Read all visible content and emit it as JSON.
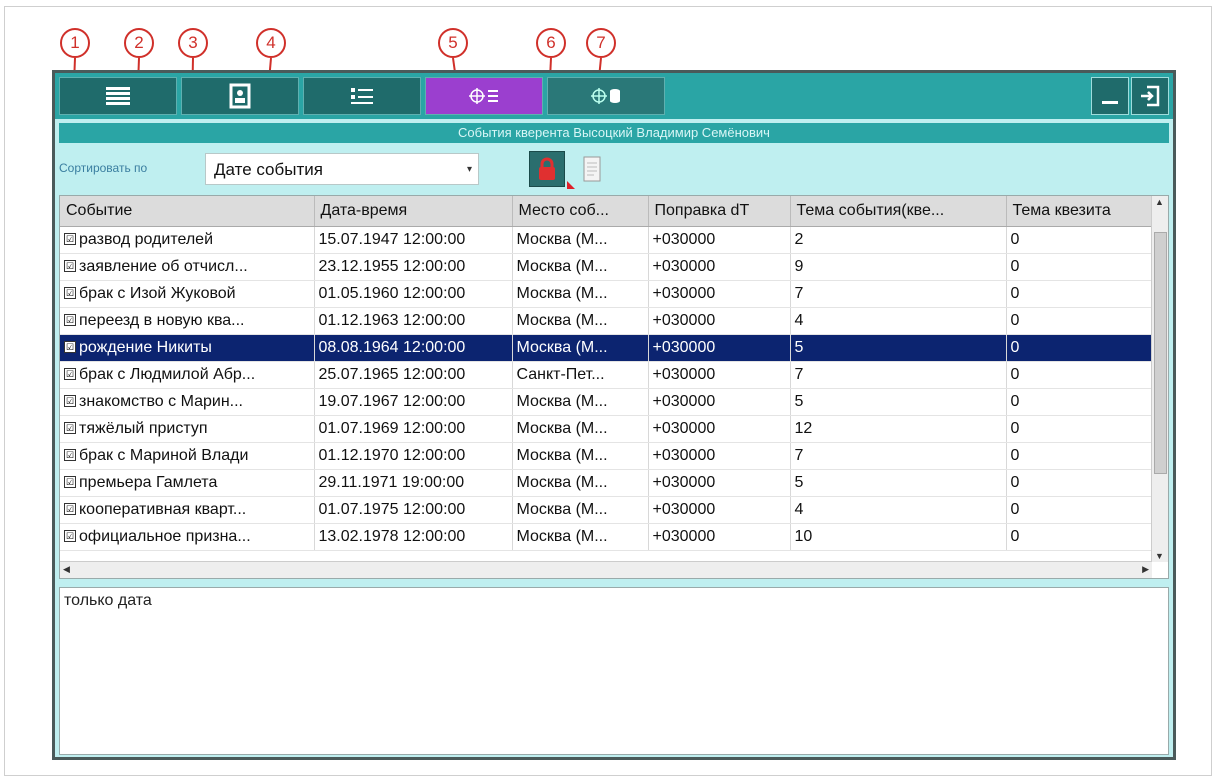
{
  "callouts": [
    "1",
    "2",
    "3",
    "4",
    "5",
    "6",
    "7"
  ],
  "toolbar": {
    "tabs": [
      {
        "icon": "list-icon"
      },
      {
        "icon": "person-card-icon"
      },
      {
        "icon": "numbered-list-icon"
      },
      {
        "icon": "target-list-icon",
        "active": true
      },
      {
        "icon": "target-database-icon"
      }
    ],
    "accent": "#2aa5a5",
    "active_color": "#9b3fcf"
  },
  "window_title": "События кверента   Высоцкий Владимир Семёнович",
  "sort": {
    "label": "Сортировать по",
    "value": "Дате события"
  },
  "table": {
    "columns": [
      "Событие",
      "Дата-время",
      "Место соб...",
      "Поправка dT",
      "Тема события(кве...",
      "Тема квезита"
    ],
    "rows": [
      [
        "развод родителей",
        "15.07.1947 12:00:00",
        "Москва (М...",
        "+030000",
        "2",
        "0"
      ],
      [
        "заявление об отчисл...",
        "23.12.1955 12:00:00",
        "Москва (М...",
        "+030000",
        "9",
        "0"
      ],
      [
        "брак с Изой Жуковой",
        "01.05.1960 12:00:00",
        "Москва (М...",
        "+030000",
        "7",
        "0"
      ],
      [
        "переезд в новую ква...",
        "01.12.1963 12:00:00",
        "Москва (М...",
        "+030000",
        "4",
        "0"
      ],
      [
        "рождение Никиты",
        "08.08.1964 12:00:00",
        "Москва (М...",
        "+030000",
        "5",
        "0"
      ],
      [
        "брак с Людмилой Абр...",
        "25.07.1965 12:00:00",
        "Санкт-Пет...",
        "+030000",
        "7",
        "0"
      ],
      [
        "знакомство с Марин...",
        "19.07.1967 12:00:00",
        "Москва (М...",
        "+030000",
        "5",
        "0"
      ],
      [
        "тяжёлый приступ",
        "01.07.1969 12:00:00",
        "Москва (М...",
        "+030000",
        "12",
        "0"
      ],
      [
        "брак с Мариной Влади",
        "01.12.1970 12:00:00",
        "Москва (М...",
        "+030000",
        "7",
        "0"
      ],
      [
        "премьера Гамлета",
        "29.11.1971 19:00:00",
        "Москва (М...",
        "+030000",
        "5",
        "0"
      ],
      [
        "кооперативная кварт...",
        "01.07.1975 12:00:00",
        "Москва (М...",
        "+030000",
        "4",
        "0"
      ],
      [
        "официальное призна...",
        "13.02.1978 12:00:00",
        "Москва (М...",
        "+030000",
        "10",
        "0"
      ]
    ],
    "selected_row": 4,
    "checkbox_mark": "☑",
    "selection_color": "#0c2470"
  },
  "notes": {
    "text": "только дата"
  }
}
